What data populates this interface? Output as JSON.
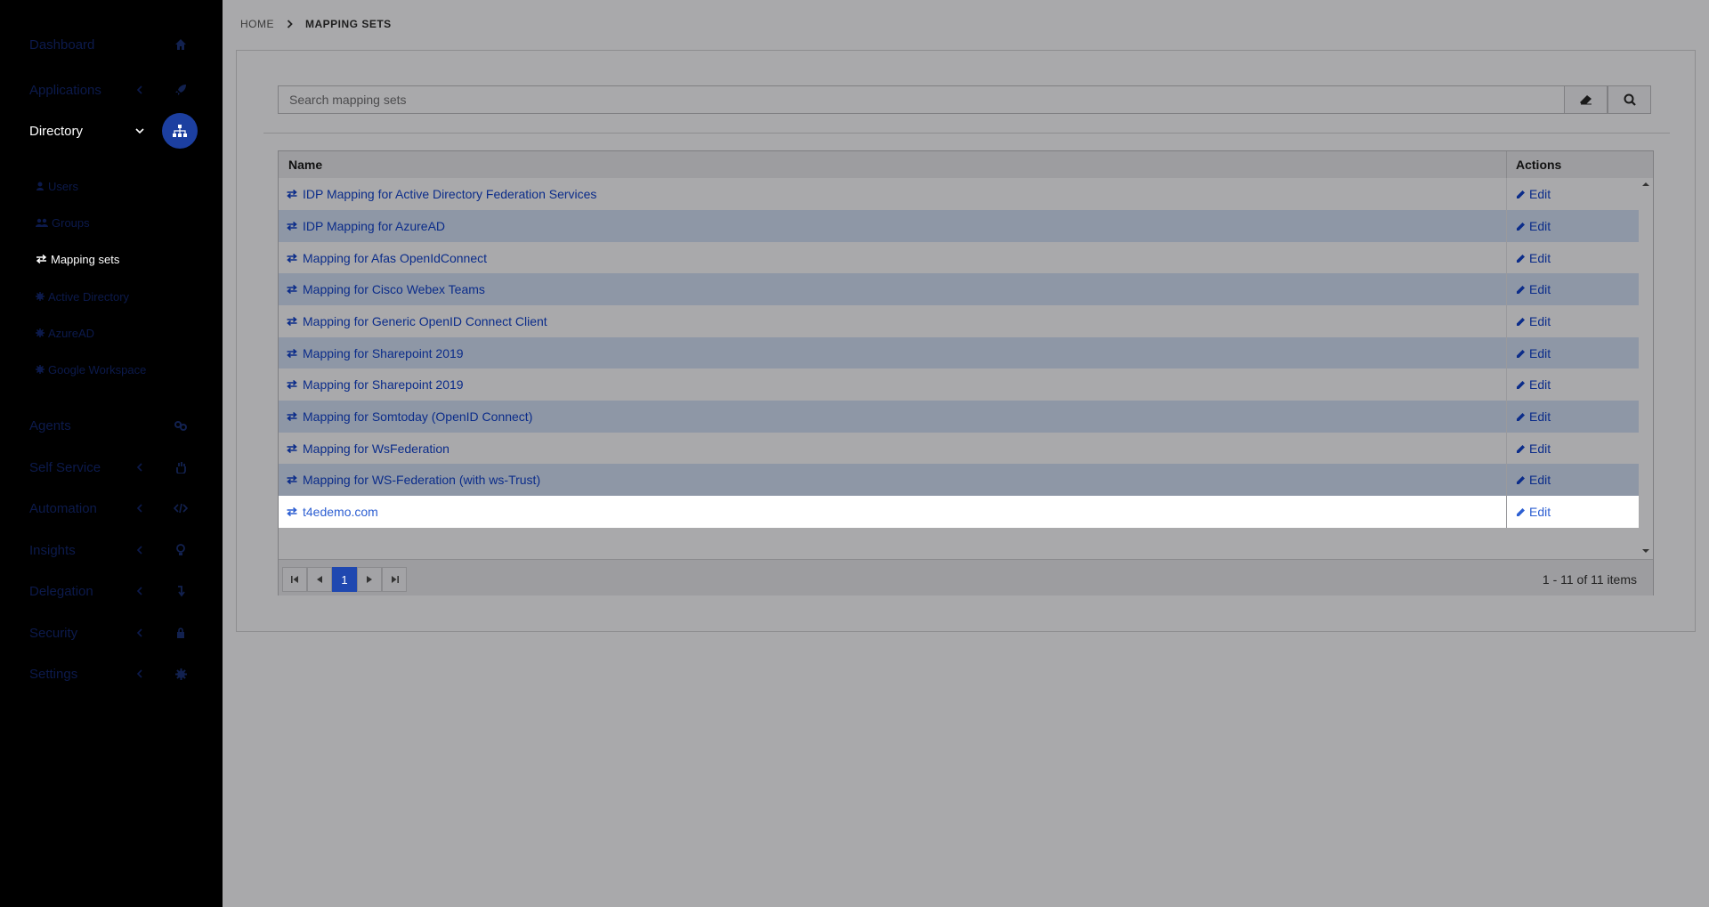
{
  "sidebar": {
    "items": [
      {
        "label": "Dashboard",
        "icon": "home-icon",
        "has_chevron": false
      },
      {
        "label": "Applications",
        "icon": "rocket-icon",
        "has_chevron": true
      },
      {
        "label": "Directory",
        "icon": "sitemap-icon",
        "has_chevron": true,
        "expanded": true,
        "active": true
      },
      {
        "label": "Agents",
        "icon": "agents-icon",
        "has_chevron": false
      },
      {
        "label": "Self Service",
        "icon": "hand-icon",
        "has_chevron": true
      },
      {
        "label": "Automation",
        "icon": "code-icon",
        "has_chevron": true
      },
      {
        "label": "Insights",
        "icon": "lightbulb-icon",
        "has_chevron": true
      },
      {
        "label": "Delegation",
        "icon": "delegation-icon",
        "has_chevron": true
      },
      {
        "label": "Security",
        "icon": "lock-icon",
        "has_chevron": true
      },
      {
        "label": "Settings",
        "icon": "gear-icon",
        "has_chevron": true
      }
    ],
    "directory_sub": [
      {
        "label": "Users",
        "icon": "user-icon"
      },
      {
        "label": "Groups",
        "icon": "users-icon"
      },
      {
        "label": "Mapping sets",
        "icon": "exchange-icon",
        "active": true
      },
      {
        "label": "Active Directory",
        "icon": "cog-icon"
      },
      {
        "label": "AzureAD",
        "icon": "cog-icon"
      },
      {
        "label": "Google Workspace",
        "icon": "cog-icon"
      }
    ]
  },
  "breadcrumb": {
    "home": "HOME",
    "current": "MAPPING SETS"
  },
  "search": {
    "placeholder": "Search mapping sets",
    "value": ""
  },
  "grid": {
    "columns": {
      "name": "Name",
      "actions": "Actions"
    },
    "rows": [
      {
        "name": "IDP Mapping for Active Directory Federation Services",
        "action": "Edit"
      },
      {
        "name": "IDP Mapping for AzureAD",
        "action": "Edit"
      },
      {
        "name": "Mapping for Afas OpenIdConnect",
        "action": "Edit"
      },
      {
        "name": "Mapping for Cisco Webex Teams",
        "action": "Edit"
      },
      {
        "name": "Mapping for Generic OpenID Connect Client",
        "action": "Edit"
      },
      {
        "name": "Mapping for Sharepoint 2019",
        "action": "Edit"
      },
      {
        "name": "Mapping for Sharepoint 2019",
        "action": "Edit"
      },
      {
        "name": "Mapping for Somtoday (OpenID Connect)",
        "action": "Edit"
      },
      {
        "name": "Mapping for WsFederation",
        "action": "Edit"
      },
      {
        "name": "Mapping for WS-Federation (with ws-Trust)",
        "action": "Edit"
      },
      {
        "name": "t4edemo.com",
        "action": "Edit",
        "selected": true
      }
    ],
    "pager": {
      "current_page": "1",
      "info": "1 - 11 of 11 items"
    }
  },
  "colors": {
    "accent": "#1f48b0",
    "link": "#0b2c8a",
    "row_alt": "#8e97a6"
  }
}
